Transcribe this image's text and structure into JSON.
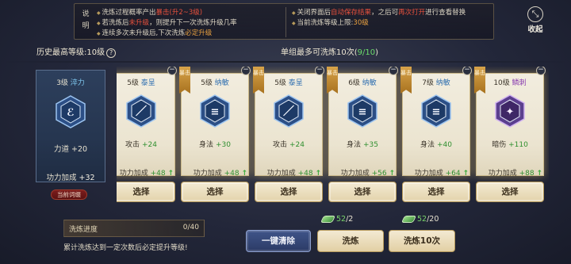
{
  "info": {
    "label": "说明",
    "col1": [
      [
        "洗炼过程概率产出",
        "暴击(升2~3级)",
        ""
      ],
      [
        "若洗炼后",
        "未升级",
        "，则提升下一次洗炼升级几率"
      ],
      [
        "连续多次未升级后,下次洗炼",
        "必定升级",
        ""
      ]
    ],
    "col2": [
      [
        "关闭界面后",
        "自动保存结果",
        "，之后可",
        "再次打开",
        "进行查看替换"
      ],
      [
        "当前洗炼等级上限:",
        "30级",
        "",
        "",
        ""
      ]
    ]
  },
  "collapse_label": "收起",
  "collapse_icon": "collapse-arrows-icon",
  "history": {
    "label": "历史最高等级:",
    "value": "10级",
    "help": "?"
  },
  "max_wash": {
    "label": "单组最多可洗炼10次(",
    "count": "9/10",
    "close": ")"
  },
  "current": {
    "level": "3级",
    "quality": "淬力",
    "icon": "rune-hex-icon",
    "stat_name": "力道",
    "stat_value": "+20",
    "bonus_label": "功力加成",
    "bonus_value": "+32",
    "tag": "当前词缀"
  },
  "crit_label": "暴击",
  "select_label": "选择",
  "cards": [
    {
      "level": "5级",
      "quality": "泰呈",
      "quality_color": "blue",
      "crit": false,
      "icon": "sword-hex-icon",
      "stat_name": "攻击",
      "stat_value": "+24",
      "bonus_label": "功力加成",
      "bonus_value": "+48"
    },
    {
      "level": "5级",
      "quality": "纳敏",
      "quality_color": "blue",
      "crit": true,
      "icon": "agility-hex-icon",
      "stat_name": "身法",
      "stat_value": "+30",
      "bonus_label": "功力加成",
      "bonus_value": "+48"
    },
    {
      "level": "5级",
      "quality": "泰呈",
      "quality_color": "blue",
      "crit": true,
      "icon": "sword-hex-icon",
      "stat_name": "攻击",
      "stat_value": "+24",
      "bonus_label": "功力加成",
      "bonus_value": "+48"
    },
    {
      "level": "6级",
      "quality": "纳敏",
      "quality_color": "blue",
      "crit": true,
      "icon": "agility-hex-icon",
      "stat_name": "身法",
      "stat_value": "+35",
      "bonus_label": "功力加成",
      "bonus_value": "+56"
    },
    {
      "level": "7级",
      "quality": "纳敏",
      "quality_color": "blue",
      "crit": true,
      "icon": "agility-hex-icon",
      "stat_name": "身法",
      "stat_value": "+40",
      "bonus_label": "功力加成",
      "bonus_value": "+64"
    },
    {
      "level": "10级",
      "quality": "鳞刺",
      "quality_color": "purple",
      "crit": true,
      "icon": "crit-hex-icon",
      "stat_name": "暗伤",
      "stat_value": "+110",
      "bonus_label": "功力加成",
      "bonus_value": "+88"
    }
  ],
  "progress": {
    "label": "洗炼进度",
    "value": "0/40",
    "fraction": 0
  },
  "hint": "累计洗炼达到一定次数后必定提升等级!",
  "buttons": {
    "clear": "一键清除",
    "wash": "洗炼",
    "wash10": "洗炼10次"
  },
  "costs": [
    {
      "have": "52",
      "need": "/2"
    },
    {
      "have": "52",
      "need": "/20"
    }
  ],
  "colors": {
    "accent_gold": "#b79a5b",
    "highlight_red": "#e6503c",
    "stat_green": "#2f8f2f",
    "quality_blue": "#2f6fb0",
    "quality_purple": "#8a3fb0"
  }
}
